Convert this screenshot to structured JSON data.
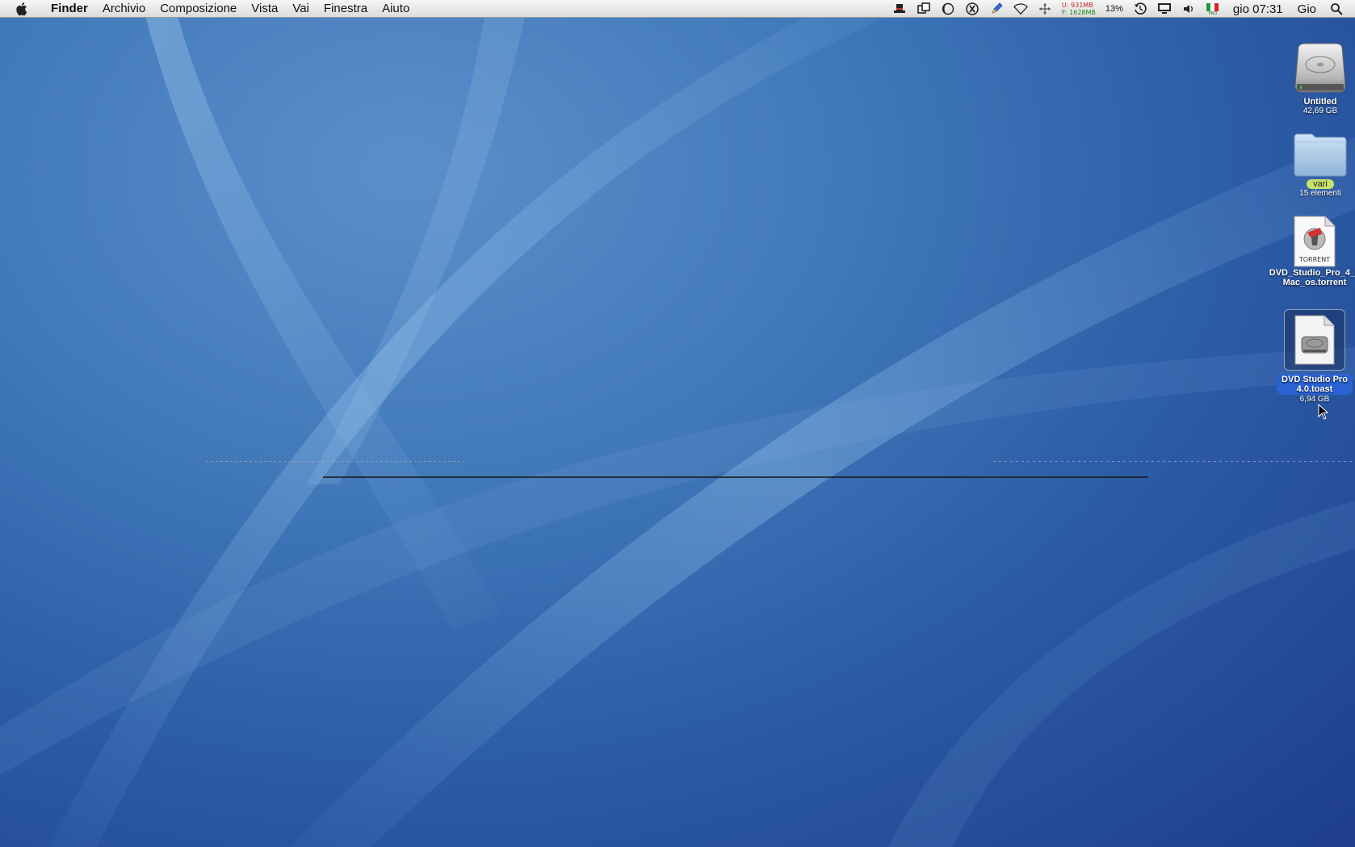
{
  "menubar": {
    "app_name": "Finder",
    "menus": [
      "Archivio",
      "Composizione",
      "Vista",
      "Vai",
      "Finestra",
      "Aiuto"
    ],
    "memory": {
      "used": "U: 931MB",
      "free": "F: 1628MB"
    },
    "battery_percent": "13%",
    "clock": "gio 07:31",
    "user": "Gio",
    "status_icons": [
      "hat-icon",
      "screen-copy-icon",
      "moon-icon",
      "x-circle-icon",
      "pen-icon",
      "wifi-icon",
      "network-arrows-icon",
      "time-machine-icon",
      "display-icon",
      "volume-icon",
      "italian-flag-icon",
      "spotlight-icon"
    ]
  },
  "desktop": {
    "icons": [
      {
        "name": "Untitled",
        "sub": "42,69 GB",
        "icon": "hard-drive-icon"
      },
      {
        "name": "vari",
        "sub": "15 elementi",
        "icon": "folder-icon"
      },
      {
        "name_line1": "DVD_Studio_Pro_4_0",
        "name_line2": "Mac_os.torrent",
        "icon": "torrent-file-icon",
        "badge": "TORRENT"
      },
      {
        "name_line1": "DVD Studio Pro",
        "name_line2": "4.0.toast",
        "sub": "6,94 GB",
        "icon": "toast-disk-image-icon"
      }
    ]
  },
  "colors": {
    "wallpaper_light": "#5b8fcb",
    "wallpaper_dark": "#1e3d8a",
    "selection_blue": "#2a62d4",
    "label_green": "#c8e26a"
  }
}
